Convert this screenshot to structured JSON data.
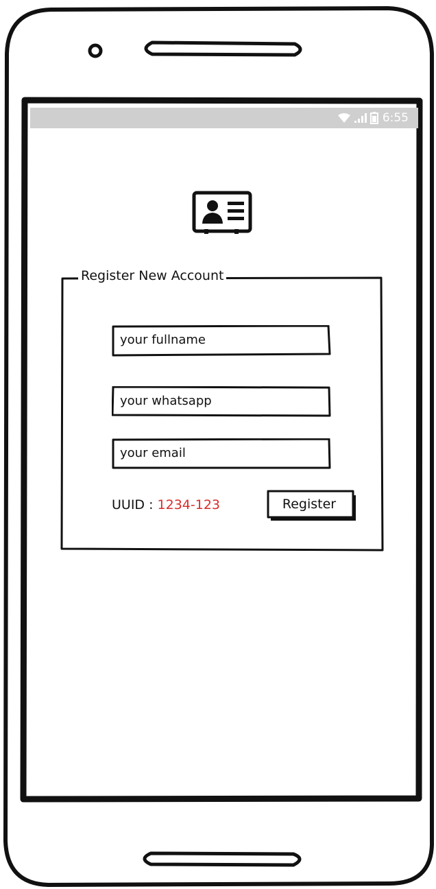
{
  "status_bar": {
    "time": "6:55",
    "icons": [
      "wifi-icon",
      "signal-icon",
      "battery-icon"
    ],
    "background": "#cfcfcf"
  },
  "app": {
    "icon": "contact-card-icon"
  },
  "form": {
    "legend": "Register New Account",
    "fullname": {
      "placeholder": "your fullname",
      "value": ""
    },
    "whatsapp": {
      "placeholder": "your whatsapp",
      "value": ""
    },
    "email": {
      "placeholder": "your email",
      "value": ""
    },
    "uuid_label": "UUID : ",
    "uuid_value": "1234-123",
    "uuid_color": "#d92b2b",
    "register_label": "Register"
  }
}
